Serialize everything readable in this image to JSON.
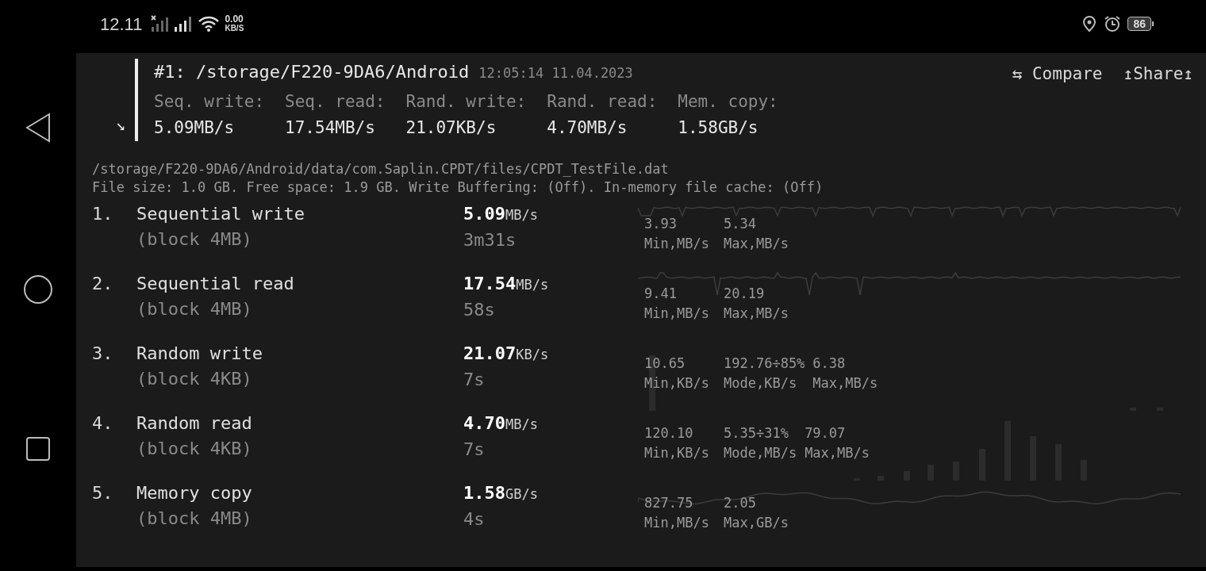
{
  "status_bar": {
    "time": "12.11",
    "net_speed": "0.00",
    "net_unit": "KB/S",
    "battery": "86"
  },
  "header": {
    "marker": "↘",
    "title": "#1: /storage/F220-9DA6/Android",
    "timestamp": "12:05:14 11.04.2023",
    "actions": [
      {
        "label": "⇆ Compare"
      },
      {
        "label": "↥Share↥"
      }
    ],
    "summary": [
      {
        "label": "Seq. write:",
        "value": "5.09MB/s"
      },
      {
        "label": "Seq. read:",
        "value": "17.54MB/s"
      },
      {
        "label": "Rand. write:",
        "value": "21.07KB/s"
      },
      {
        "label": "Rand. read:",
        "value": "4.70MB/s"
      },
      {
        "label": "Mem. copy:",
        "value": "1.58GB/s"
      }
    ]
  },
  "path": "/storage/F220-9DA6/Android/data/com.Saplin.CPDT/files/CPDT_TestFile.dat",
  "file_info": "File size: 1.0 GB. Free space: 1.9 GB. Write Buffering: (Off). In-memory file cache: (Off)",
  "tests": [
    {
      "index": "1.",
      "name": "Sequential write",
      "block": "(block 4MB)",
      "value": "5.09",
      "unit": "MB/s",
      "duration": "3m31s",
      "graph": {
        "kind": "spikes"
      },
      "stats": [
        {
          "value": "3.93",
          "label": "Min,MB/s"
        },
        {
          "value": "5.34",
          "label": "Max,MB/s"
        }
      ]
    },
    {
      "index": "2.",
      "name": "Sequential read",
      "block": "(block 4MB)",
      "value": "17.54",
      "unit": "MB/s",
      "duration": "58s",
      "graph": {
        "kind": "spikes"
      },
      "stats": [
        {
          "value": "9.41",
          "label": "Min,MB/s"
        },
        {
          "value": "20.19",
          "label": "Max,MB/s"
        }
      ]
    },
    {
      "index": "3.",
      "name": "Random write",
      "block": "(block 4KB)",
      "value": "21.07",
      "unit": "KB/s",
      "duration": "7s",
      "graph": {
        "kind": "sparse"
      },
      "stats": [
        {
          "value": "10.65",
          "label": "Min,KB/s"
        },
        {
          "value": "192.76÷85%",
          "label": "Mode,KB/s"
        },
        {
          "value": "6.38",
          "label": "Max,MB/s"
        }
      ]
    },
    {
      "index": "4.",
      "name": "Random read",
      "block": "(block 4KB)",
      "value": "4.70",
      "unit": "MB/s",
      "duration": "7s",
      "graph": {
        "kind": "histogram"
      },
      "stats": [
        {
          "value": "120.10",
          "label": "Min,KB/s"
        },
        {
          "value": "5.35÷31%",
          "label": "Mode,MB/s"
        },
        {
          "value": "79.07",
          "label": "Max,MB/s"
        }
      ]
    },
    {
      "index": "5.",
      "name": "Memory copy",
      "block": "(block 4MB)",
      "value": "1.58",
      "unit": "GB/s",
      "duration": "4s",
      "graph": {
        "kind": "wave"
      },
      "stats": [
        {
          "value": "827.75",
          "label": "Min,MB/s"
        },
        {
          "value": "2.05",
          "label": "Max,GB/s"
        }
      ]
    }
  ]
}
